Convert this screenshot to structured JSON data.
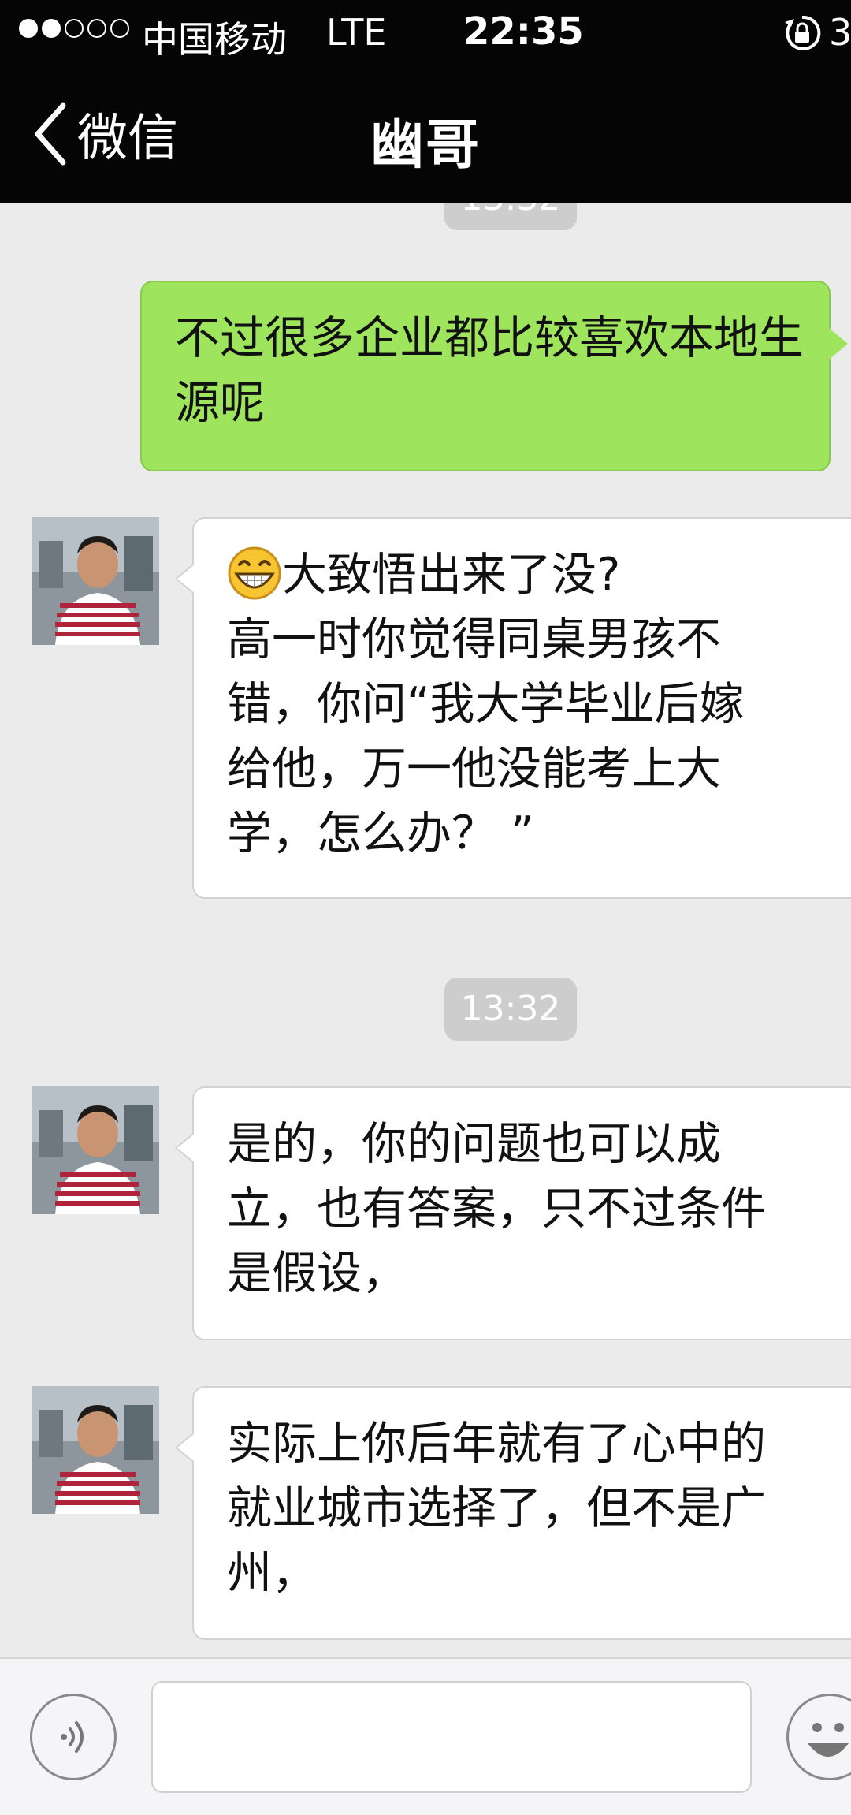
{
  "status_bar": {
    "carrier": "中国移动",
    "network": "LTE",
    "time": "22:35",
    "battery_partial": "3",
    "icons": [
      "signal-dots",
      "rotation-lock-icon"
    ]
  },
  "nav": {
    "back_label": "微信",
    "title": "幽哥"
  },
  "chat": {
    "top_time_partial": "13:32",
    "messages": [
      {
        "direction": "out",
        "text": "不过很多企业都比较喜欢本地生源呢"
      },
      {
        "direction": "in",
        "emoji": "grin-icon",
        "lines": [
          "大致悟出来了没?",
          "高一时你觉得同桌男孩不",
          "错，你问“我大学毕业后嫁",
          "给他，万一他没能考上大",
          "学，怎么办？ ”"
        ]
      },
      {
        "type": "time",
        "text": "13:32"
      },
      {
        "direction": "in",
        "lines": [
          "是的，你的问题也可以成",
          "立，也有答案，只不过条件",
          "是假设，"
        ]
      },
      {
        "direction": "in",
        "lines": [
          "实际上你后年就有了心中的",
          "就业城市选择了，但不是广",
          "州，"
        ]
      }
    ]
  },
  "input_bar": {
    "placeholder": "",
    "icons": [
      "voice-icon",
      "emoji-icon"
    ]
  },
  "colors": {
    "nav_bg": "#050505",
    "chat_bg": "#ebebeb",
    "out_bubble": "#9ee45c",
    "in_bubble": "#ffffff",
    "time_chip": "#cdcdcd"
  }
}
